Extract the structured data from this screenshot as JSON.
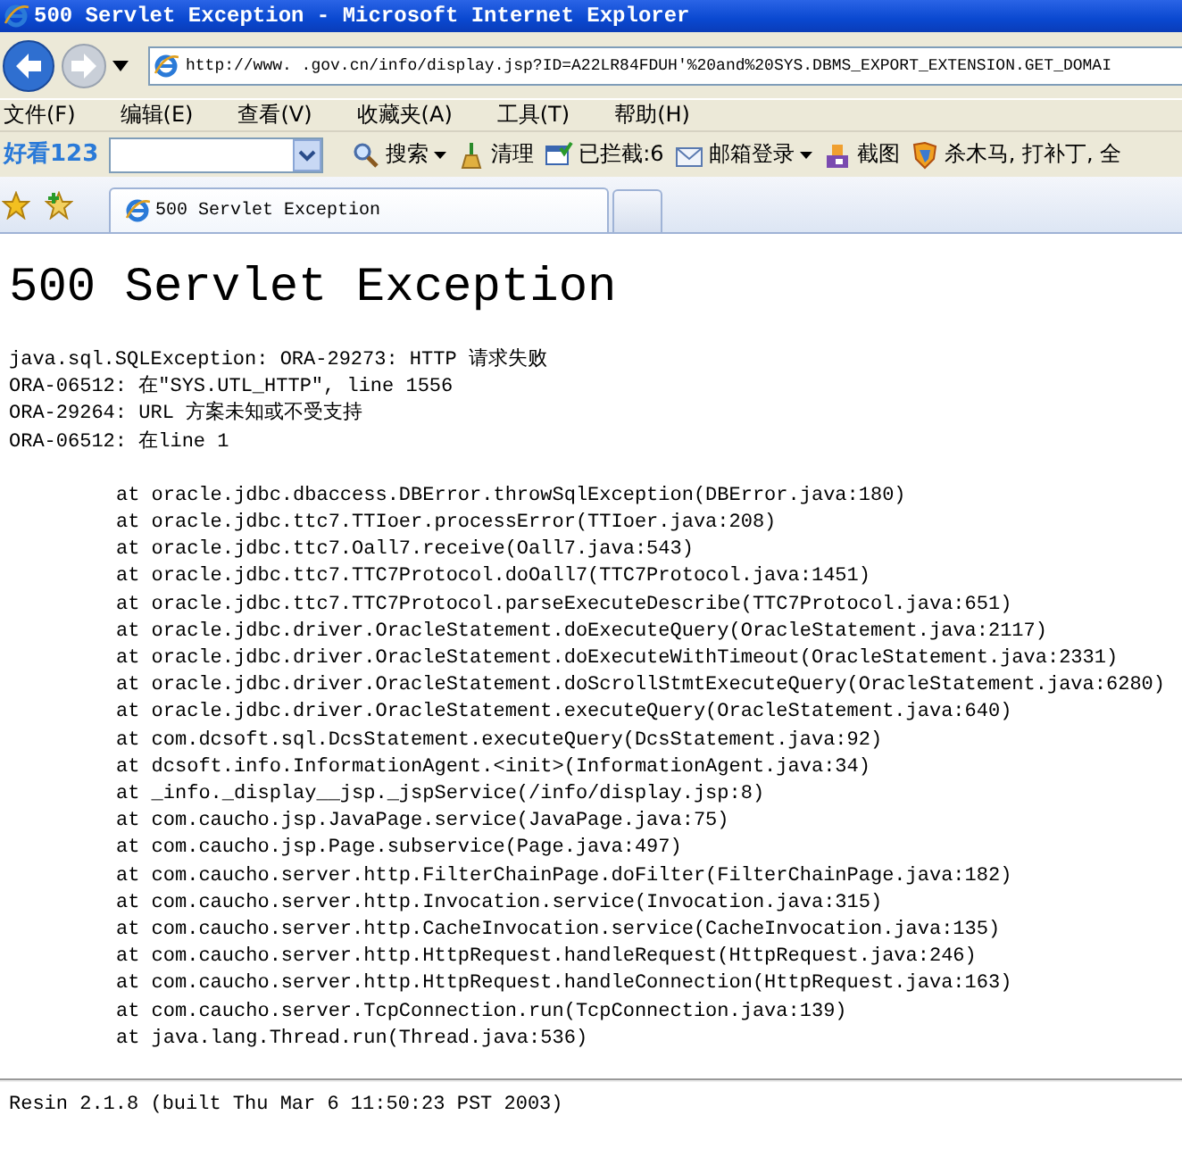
{
  "window": {
    "title": "500 Servlet Exception - Microsoft Internet Explorer"
  },
  "address_bar": {
    "url": "http://www.   .gov.cn/info/display.jsp?ID=A22LR84FDUH'%20and%20SYS.DBMS_EXPORT_EXTENSION.GET_DOMAI"
  },
  "menu_bar": [
    "文件(F)",
    "编辑(E)",
    "查看(V)",
    "收藏夹(A)",
    "工具(T)",
    "帮助(H)"
  ],
  "toolbar": {
    "logo": "好看123",
    "items": [
      {
        "label": "搜索",
        "has_dropdown": true
      },
      {
        "label": "清理",
        "has_dropdown": false
      },
      {
        "label": "已拦截:6",
        "has_dropdown": false
      },
      {
        "label": "邮箱登录",
        "has_dropdown": true
      },
      {
        "label": "截图",
        "has_dropdown": false
      },
      {
        "label": "杀木马, 打补丁, 全",
        "has_dropdown": false
      }
    ]
  },
  "tabs": [
    {
      "label": "500 Servlet Exception",
      "selected": true
    }
  ],
  "page": {
    "heading": "500 Servlet Exception",
    "error_lines": [
      "java.sql.SQLException: ORA-29273: HTTP 请求失败",
      "ORA-06512: 在\"SYS.UTL_HTTP\", line 1556",
      "ORA-29264: URL 方案未知或不受支持",
      "ORA-06512: 在line 1"
    ],
    "stack_trace": [
      "at oracle.jdbc.dbaccess.DBError.throwSqlException(DBError.java:180)",
      "at oracle.jdbc.ttc7.TTIoer.processError(TTIoer.java:208)",
      "at oracle.jdbc.ttc7.Oall7.receive(Oall7.java:543)",
      "at oracle.jdbc.ttc7.TTC7Protocol.doOall7(TTC7Protocol.java:1451)",
      "at oracle.jdbc.ttc7.TTC7Protocol.parseExecuteDescribe(TTC7Protocol.java:651)",
      "at oracle.jdbc.driver.OracleStatement.doExecuteQuery(OracleStatement.java:2117)",
      "at oracle.jdbc.driver.OracleStatement.doExecuteWithTimeout(OracleStatement.java:2331)",
      "at oracle.jdbc.driver.OracleStatement.doScrollStmtExecuteQuery(OracleStatement.java:6280)",
      "at oracle.jdbc.driver.OracleStatement.executeQuery(OracleStatement.java:640)",
      "at com.dcsoft.sql.DcsStatement.executeQuery(DcsStatement.java:92)",
      "at dcsoft.info.InformationAgent.<init>(InformationAgent.java:34)",
      "at _info._display__jsp._jspService(/info/display.jsp:8)",
      "at com.caucho.jsp.JavaPage.service(JavaPage.java:75)",
      "at com.caucho.jsp.Page.subservice(Page.java:497)",
      "at com.caucho.server.http.FilterChainPage.doFilter(FilterChainPage.java:182)",
      "at com.caucho.server.http.Invocation.service(Invocation.java:315)",
      "at com.caucho.server.http.CacheInvocation.service(CacheInvocation.java:135)",
      "at com.caucho.server.http.HttpRequest.handleRequest(HttpRequest.java:246)",
      "at com.caucho.server.http.HttpRequest.handleConnection(HttpRequest.java:163)",
      "at com.caucho.server.TcpConnection.run(TcpConnection.java:139)",
      "at java.lang.Thread.run(Thread.java:536)"
    ],
    "footer": "Resin 2.1.8 (built Thu Mar 6 11:50:23 PST 2003)"
  }
}
